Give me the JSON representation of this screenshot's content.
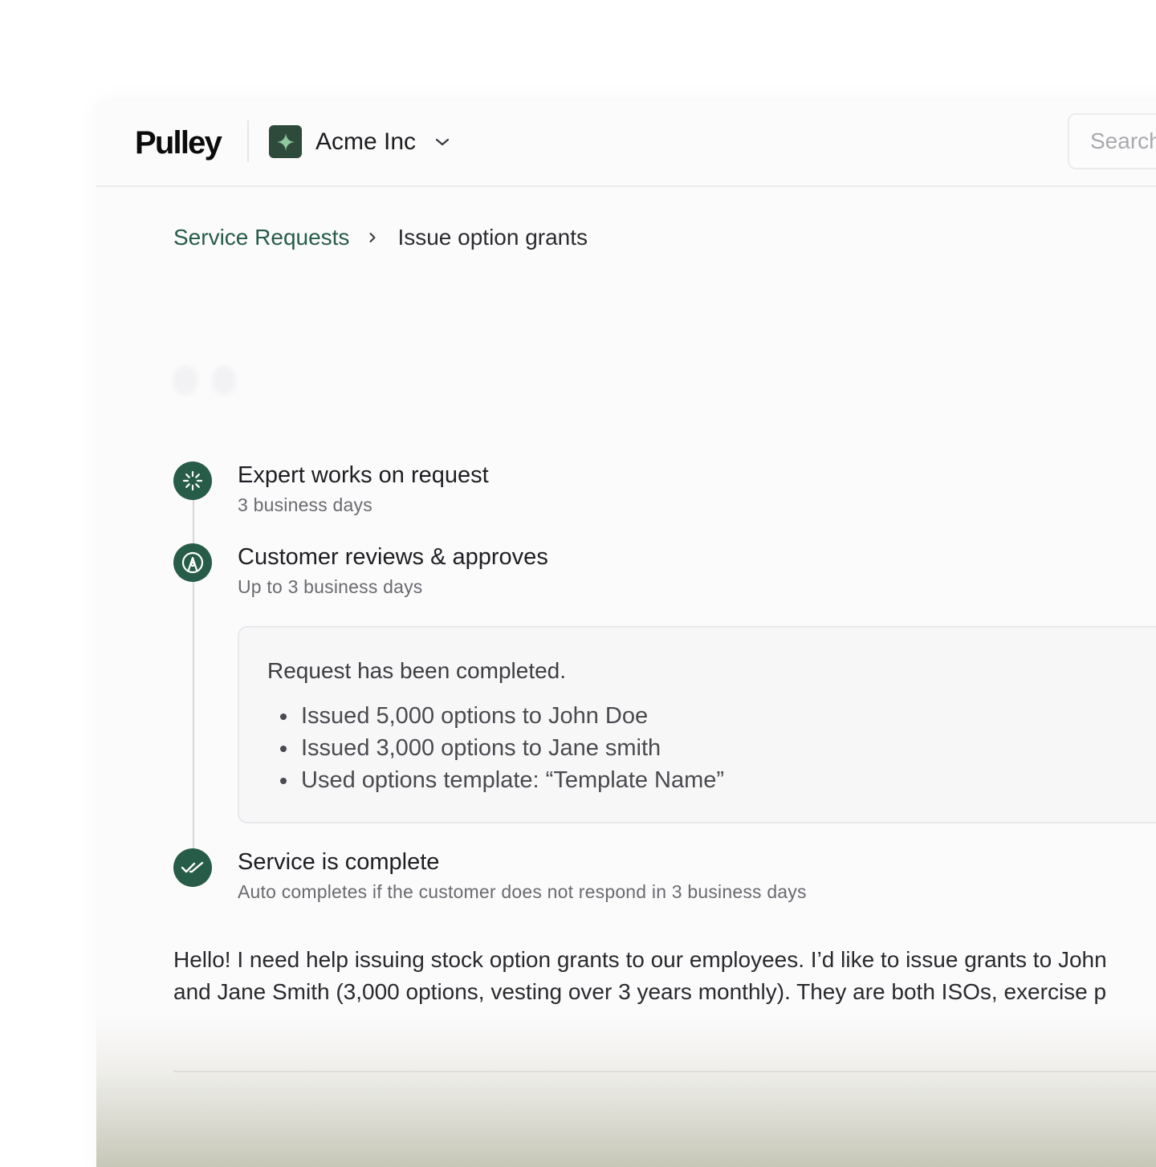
{
  "header": {
    "logo_text": "Pulley",
    "company_name": "Acme Inc",
    "search_placeholder": "Search"
  },
  "breadcrumb": {
    "parent_label": "Service Requests",
    "current_label": "Issue option grants"
  },
  "timeline": {
    "steps": [
      {
        "title": "Expert works on request",
        "subtitle": "3 business days",
        "icon": "loader-icon"
      },
      {
        "title": "Customer reviews & approves",
        "subtitle": "Up to 3 business days",
        "icon": "pen-nib-icon"
      },
      {
        "title": "Service is complete",
        "subtitle": "Auto completes if the customer does not respond in 3 business days",
        "icon": "double-check-icon"
      }
    ]
  },
  "completion_card": {
    "title": "Request has been completed.",
    "items": [
      "Issued 5,000 options to John Doe",
      "Issued 3,000 options to Jane smith",
      "Used options template: “Template Name”"
    ]
  },
  "message": {
    "lines": [
      "Hello! I need help issuing stock option grants to our employees. I’d like to issue grants to John",
      "and Jane Smith (3,000 options, vesting over 3 years monthly). They are both ISOs, exercise p"
    ]
  },
  "colors": {
    "accent": "#265c48",
    "company_badge": "#2e4a3a",
    "badge_star": "#8fc79e"
  }
}
